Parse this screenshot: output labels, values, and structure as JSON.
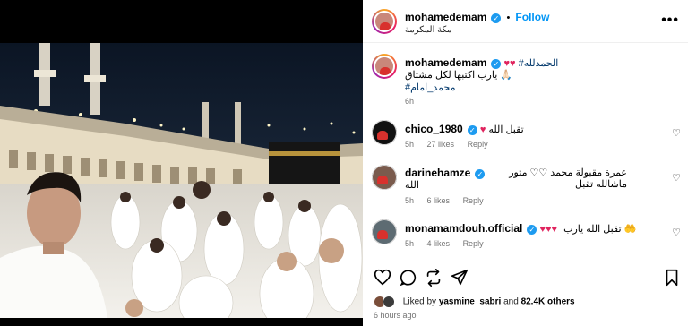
{
  "post": {
    "author": "mohamedemam",
    "follow_label": "Follow",
    "dot": "•",
    "location": "مكة المكرمة",
    "caption_hashtag": "#الحمدلله",
    "caption_hearts": "♥♥",
    "caption_line2": "يارب اكتبها لكل مشتاق 🙏🏻",
    "caption_tag": "#محمد_امام",
    "caption_time": "6h",
    "likes_prefix": "Liked by",
    "likes_user": "yasmine_sabri",
    "likes_mid": "and",
    "likes_count": "82.4K others",
    "time_ago": "6 hours ago"
  },
  "comments": [
    {
      "user": "chico_1980",
      "hearts": "♥",
      "text": "تقبل الله",
      "time": "5h",
      "likes": "27 likes",
      "reply": "Reply"
    },
    {
      "user": "darinehamze",
      "text_line1": "عمرة مقبولة محمد ♡♡ متور ماشالله تقبل",
      "text_line2": "الله",
      "time": "5h",
      "likes": "6 likes",
      "reply": "Reply"
    },
    {
      "user": "monamamdouh.official",
      "hearts": "♥♥♥",
      "text": "تقبل الله يارب 🤲",
      "time": "5h",
      "likes": "4 likes",
      "reply": "Reply"
    }
  ],
  "icons": {
    "verified": "✓",
    "more": "•••",
    "heart_small": "♡",
    "like": "heart-icon",
    "comment": "comment-icon",
    "share": "share-icon",
    "send": "send-icon",
    "save": "bookmark-icon"
  },
  "colors": {
    "link": "#0095f6",
    "verified": "#1d9bf0",
    "heart": "#e0245e"
  }
}
